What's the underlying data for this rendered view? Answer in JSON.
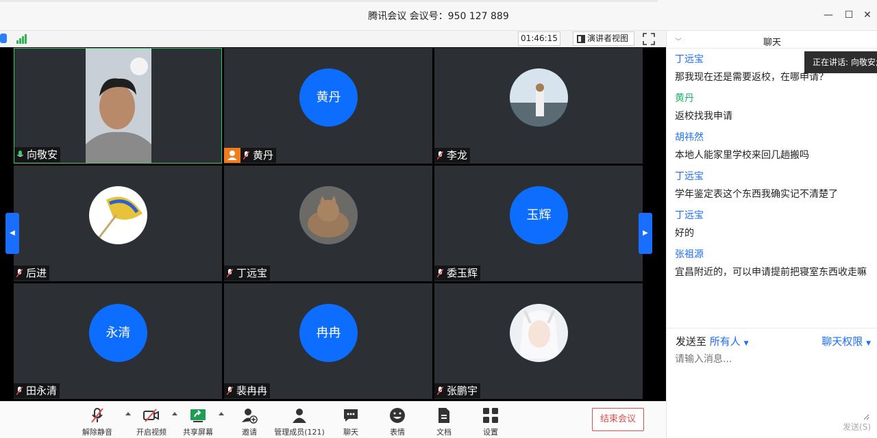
{
  "window": {
    "title": "腾讯会议 会议号：950 127 889",
    "minimize": "—",
    "maximize": "☐",
    "close": "✕"
  },
  "top_toolbar": {
    "timer": "01:46:15",
    "speaker_view_label": "演讲者视图"
  },
  "participants": [
    {
      "name": "向敬安",
      "avatar": "",
      "photo": true,
      "active": true,
      "mic": "on"
    },
    {
      "name": "黄丹",
      "avatar": "黄丹",
      "photo": false,
      "host": true,
      "mic": "muted"
    },
    {
      "name": "李龙",
      "avatar": "",
      "photo": true,
      "mic": "muted"
    },
    {
      "name": "后进",
      "avatar": "",
      "photo": true,
      "mic": "muted"
    },
    {
      "name": "丁远宝",
      "avatar": "",
      "photo": true,
      "mic": "muted"
    },
    {
      "name": "委玉辉",
      "avatar": "玉辉",
      "photo": false,
      "mic": "muted"
    },
    {
      "name": "田永清",
      "avatar": "永清",
      "photo": false,
      "mic": "muted"
    },
    {
      "name": "裴冉冉",
      "avatar": "冉冉",
      "photo": false,
      "mic": "muted"
    },
    {
      "name": "张鹏宇",
      "avatar": "",
      "photo": true,
      "mic": "muted"
    }
  ],
  "bottom_toolbar": {
    "unmute": "解除静音",
    "video": "开启视频",
    "share": "共享屏幕",
    "invite": "邀请",
    "members": "管理成员(121)",
    "chat": "聊天",
    "emoji": "表情",
    "docs": "文档",
    "settings": "设置",
    "end": "结束会议"
  },
  "chat": {
    "title": "聊天",
    "speaking_tip": "正在讲话: 向敬安;",
    "messages": [
      {
        "sender": "丁远宝",
        "color": "#1a6eff",
        "text": "那我现在还是需要返校，在哪申请？"
      },
      {
        "sender": "黄丹",
        "color": "#21b36b",
        "text": "返校找我申请"
      },
      {
        "sender": "胡祎然",
        "color": "#1a6eff",
        "text": "本地人能家里学校来回几趟搬吗"
      },
      {
        "sender": "丁远宝",
        "color": "#1a6eff",
        "text": "学年鉴定表这个东西我确实记不清楚了"
      },
      {
        "sender": "丁远宝",
        "color": "#1a6eff",
        "text": "好的"
      },
      {
        "sender": "张祖源",
        "color": "#1a6eff",
        "text": "宜昌附近的，可以申请提前把寝室东西收走嘛"
      }
    ],
    "send_to_label": "发送至",
    "send_to_target": "所有人",
    "permission": "聊天权限",
    "input_placeholder": "请输入消息...",
    "send_button": "发送(S)"
  },
  "colors": {
    "accent": "#1a6eff",
    "avatar_blue": "#0c6dff",
    "end_red": "#e84b4b",
    "active_border": "#3bc86a"
  }
}
